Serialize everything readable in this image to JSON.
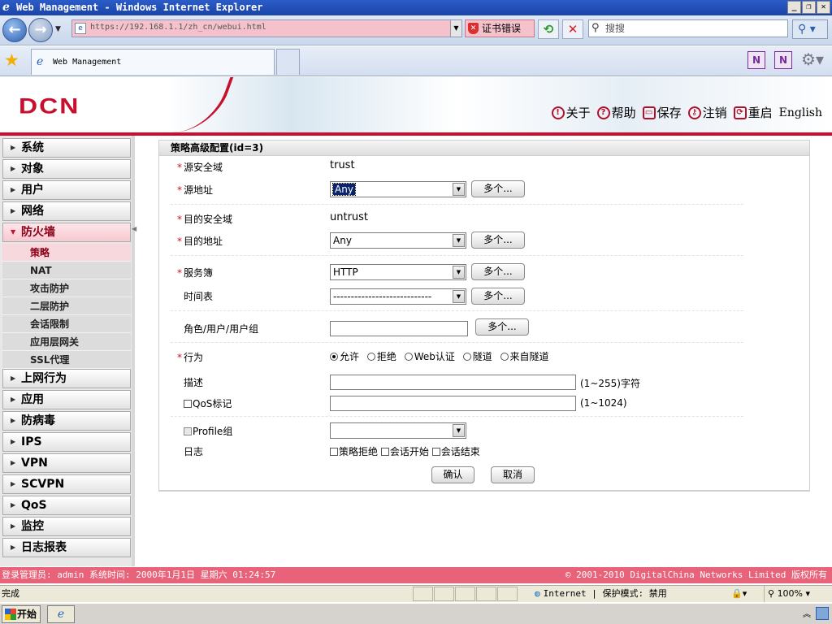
{
  "window": {
    "title": "Web Management - Windows Internet Explorer"
  },
  "browser": {
    "url": "https://192.168.1.1/zh_cn/webui.html",
    "cert_error": "证书错误",
    "search_placeholder": "搜搜",
    "tab_title": "Web Management"
  },
  "header": {
    "logo": "DCN",
    "links": {
      "about": "关于",
      "help": "帮助",
      "save": "保存",
      "logout": "注销",
      "restart": "重启",
      "english": "English"
    }
  },
  "sidebar": {
    "items": [
      {
        "label": "系统"
      },
      {
        "label": "对象"
      },
      {
        "label": "用户"
      },
      {
        "label": "网络"
      },
      {
        "label": "防火墙",
        "active": true
      }
    ],
    "subitems": [
      {
        "label": "策略",
        "active": true
      },
      {
        "label": "NAT"
      },
      {
        "label": "攻击防护"
      },
      {
        "label": "二层防护"
      },
      {
        "label": "会话限制"
      },
      {
        "label": "应用层网关"
      },
      {
        "label": "SSL代理"
      }
    ],
    "items_after": [
      {
        "label": "上网行为"
      },
      {
        "label": "应用"
      },
      {
        "label": "防病毒"
      },
      {
        "label": "IPS"
      },
      {
        "label": "VPN"
      },
      {
        "label": "SCVPN"
      },
      {
        "label": "QoS"
      },
      {
        "label": "监控"
      },
      {
        "label": "日志报表"
      }
    ]
  },
  "form": {
    "title": "策略高级配置(id=3)",
    "required_mark": "*",
    "src_zone": {
      "label": "源安全域",
      "value": "trust"
    },
    "src_addr": {
      "label": "源地址",
      "value": "Any",
      "more": "多个..."
    },
    "dst_zone": {
      "label": "目的安全域",
      "value": "untrust"
    },
    "dst_addr": {
      "label": "目的地址",
      "value": "Any",
      "more": "多个..."
    },
    "service": {
      "label": "服务簿",
      "value": "HTTP",
      "more": "多个..."
    },
    "schedule": {
      "label": "时间表",
      "value": "----------------------------",
      "more": "多个..."
    },
    "role": {
      "label": "角色/用户/用户组",
      "value": "",
      "more": "多个..."
    },
    "action": {
      "label": "行为",
      "options": [
        "允许",
        "拒绝",
        "Web认证",
        "隧道",
        "来自隧道"
      ],
      "selected": "允许"
    },
    "description": {
      "label": "描述",
      "value": "",
      "hint": "(1~255)字符"
    },
    "qos": {
      "label": "QoS标记",
      "value": "",
      "hint": "(1~1024)"
    },
    "profile": {
      "label": "Profile组",
      "value": ""
    },
    "log": {
      "label": "日志",
      "options": [
        "策略拒绝",
        "会话开始",
        "会话结束"
      ]
    },
    "ok_label": "确认",
    "cancel_label": "取消"
  },
  "statusbar": {
    "left": "登录管理员: admin 系统时间: 2000年1月1日 星期六 01:24:57",
    "right": "© 2001-2010 DigitalChina Networks Limited 版权所有"
  },
  "iestatus": {
    "done": "完成",
    "zone": "Internet | 保护模式: 禁用",
    "zoom": "100%"
  },
  "taskbar": {
    "start": "开始"
  }
}
